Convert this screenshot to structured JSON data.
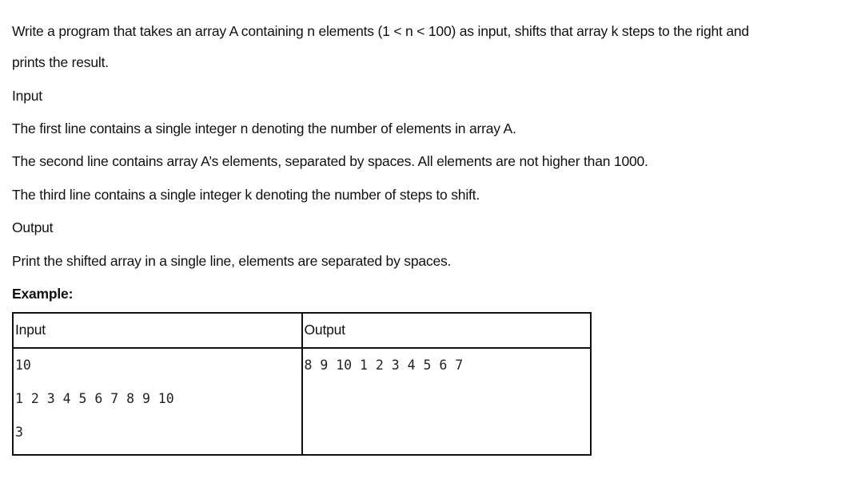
{
  "intro": {
    "line1": "Write a program that takes an array A containing n elements (1 < n < 100) as input, shifts that array k steps to the right and",
    "line2": "prints the result."
  },
  "input_section": {
    "heading": "Input",
    "line1": "The first line contains a single integer n denoting the number of elements in array A.",
    "line2": "The second line contains array A’s elements, separated by spaces. All elements are not higher than 1000.",
    "line3": "The third line contains a single integer k denoting the number of steps to shift."
  },
  "output_section": {
    "heading": "Output",
    "line1": "Print the shifted array in a single line, elements are separated by spaces."
  },
  "example": {
    "heading": "Example:",
    "table": {
      "headers": [
        "Input",
        "Output"
      ],
      "input_lines": [
        "10",
        "1 2 3 4 5 6 7 8 9 10",
        "3"
      ],
      "output_lines": [
        "8 9 10 1 2 3 4 5 6 7"
      ]
    }
  }
}
